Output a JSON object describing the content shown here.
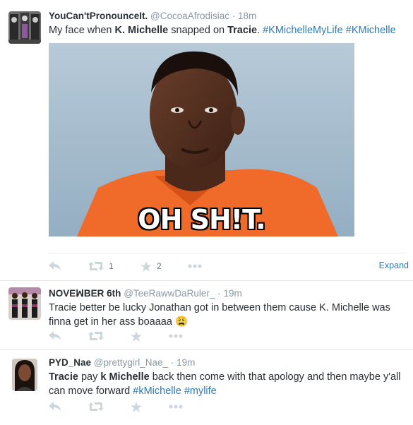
{
  "tweets": [
    {
      "name": "YouCan'tPronounceIt.",
      "handle": "@CocoaAfrodisiac",
      "dot": "·",
      "time": "18m",
      "text": [
        {
          "t": "My face when ",
          "s": "plain"
        },
        {
          "t": "K. Michelle",
          "s": "bold"
        },
        {
          "t": " snapped on ",
          "s": "plain"
        },
        {
          "t": "Tracie",
          "s": "bold"
        },
        {
          "t": ". ",
          "s": "plain"
        },
        {
          "t": "#KMichelleMyLife",
          "s": "hashtag"
        },
        {
          "t": " ",
          "s": "plain"
        },
        {
          "t": "#KMichelle",
          "s": "hashtag"
        }
      ],
      "media_caption": "OH SH!T.",
      "retweet_count": "1",
      "favorite_count": "2",
      "expand_label": "Expand"
    },
    {
      "name": "NOVEꟽBER 6th",
      "handle": "@TeeRawwDaRuler_",
      "dot": "·",
      "time": "19m",
      "text": [
        {
          "t": "Tracie better be lucky Jonathan got in between them cause K. Michelle was finna get in her ass boaaaa ",
          "s": "plain"
        },
        {
          "t": "😩",
          "s": "emoji"
        }
      ]
    },
    {
      "name": "PYD_Nae",
      "handle": "@prettygirl_Nae_",
      "dot": "·",
      "time": "19m",
      "text": [
        {
          "t": "Tracie",
          "s": "bold"
        },
        {
          "t": " pay ",
          "s": "plain"
        },
        {
          "t": "k Michelle",
          "s": "bold"
        },
        {
          "t": " back then come with that apology and then maybe y'all can move forward ",
          "s": "plain"
        },
        {
          "t": "#kMichelle",
          "s": "hashtag"
        },
        {
          "t": " ",
          "s": "plain"
        },
        {
          "t": "#mylife",
          "s": "hashtag"
        }
      ]
    }
  ],
  "icons": {
    "reply": "reply-icon",
    "retweet": "retweet-icon",
    "favorite": "star-icon",
    "more": "more-icon"
  },
  "colors": {
    "hashtag": "#2b7bb9",
    "muted": "#8899a6",
    "action_icon": "#ccd6dd",
    "separator": "#e1e8ed"
  }
}
